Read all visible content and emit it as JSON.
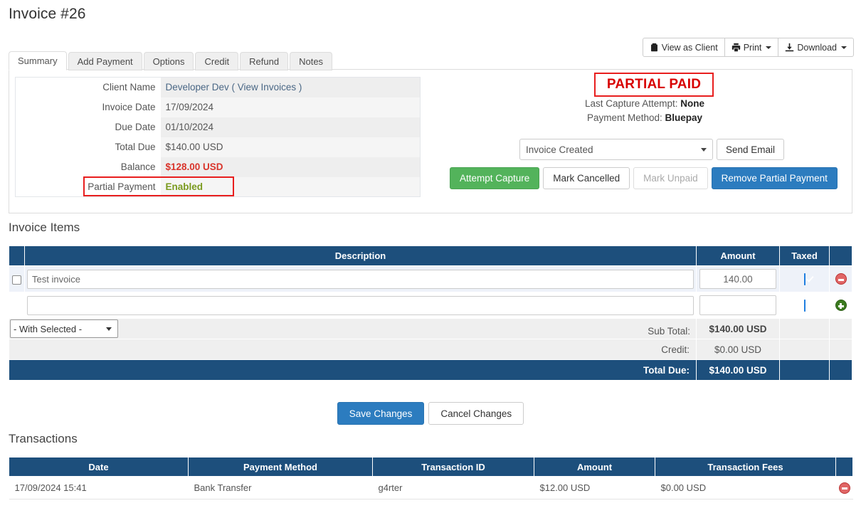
{
  "page": {
    "title": "Invoice #26"
  },
  "toolbar": {
    "view_as_client": "View as Client",
    "print": "Print",
    "download": "Download"
  },
  "tabs": [
    {
      "label": "Summary",
      "active": true
    },
    {
      "label": "Add Payment",
      "active": false
    },
    {
      "label": "Options",
      "active": false
    },
    {
      "label": "Credit",
      "active": false
    },
    {
      "label": "Refund",
      "active": false
    },
    {
      "label": "Notes",
      "active": false
    }
  ],
  "summary": {
    "rows": [
      {
        "label": "Client Name",
        "value": "Developer Dev ( View Invoices )"
      },
      {
        "label": "Invoice Date",
        "value": "17/09/2024"
      },
      {
        "label": "Due Date",
        "value": "01/10/2024"
      },
      {
        "label": "Total Due",
        "value": "$140.00 USD"
      },
      {
        "label": "Balance",
        "value": "$128.00 USD"
      },
      {
        "label": "Partial Payment",
        "value": "Enabled"
      }
    ]
  },
  "status": {
    "badge": "PARTIAL PAID",
    "last_capture_label": "Last Capture Attempt:",
    "last_capture_value": "None",
    "payment_method_label": "Payment Method:",
    "payment_method_value": "Bluepay",
    "email_template_selected": "Invoice Created",
    "send_email_label": "Send Email",
    "actions": [
      {
        "label": "Attempt Capture",
        "style": "green"
      },
      {
        "label": "Mark Cancelled",
        "style": "white"
      },
      {
        "label": "Mark Unpaid",
        "style": "muted"
      },
      {
        "label": "Remove Partial Payment",
        "style": "blue"
      }
    ]
  },
  "items": {
    "section_title": "Invoice Items",
    "headers": {
      "check": "",
      "description": "Description",
      "amount": "Amount",
      "taxed": "Taxed",
      "action": ""
    },
    "rows": [
      {
        "description": "Test invoice",
        "amount": "140.00",
        "taxed": true,
        "action": "remove"
      },
      {
        "description": "",
        "amount": "",
        "taxed": true,
        "action": "add"
      }
    ],
    "with_selected": "- With Selected -",
    "totals": [
      {
        "label": "Sub Total:",
        "value": "$140.00 USD",
        "strong": true
      },
      {
        "label": "Credit:",
        "value": "$0.00 USD",
        "strong": false
      }
    ],
    "grand_total": {
      "label": "Total Due:",
      "value": "$140.00 USD"
    }
  },
  "buttons": {
    "save_changes": "Save Changes",
    "cancel_changes": "Cancel Changes"
  },
  "transactions": {
    "section_title": "Transactions",
    "headers": [
      "Date",
      "Payment Method",
      "Transaction ID",
      "Amount",
      "Transaction Fees",
      ""
    ],
    "rows": [
      {
        "date": "17/09/2024 15:41",
        "payment_method": "Bank Transfer",
        "transaction_id": "g4rter",
        "amount": "$12.00 USD",
        "fees": "$0.00 USD"
      }
    ]
  },
  "colors": {
    "header_blue": "#1d4f7c",
    "primary_blue": "#2c7cbf",
    "green": "#53b35b",
    "alert_red": "#e81e1e",
    "balance_red": "#d9342b",
    "enabled_green": "#7a9a1e"
  }
}
